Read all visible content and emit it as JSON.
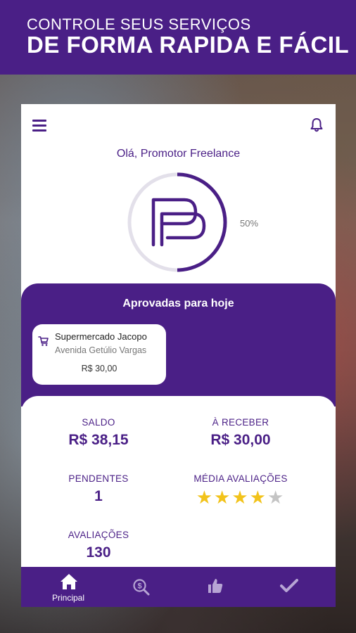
{
  "banner": {
    "line1": "CONTROLE SEUS SERVIÇOS",
    "line2": "DE FORMA RAPIDA E FÁCIL"
  },
  "header": {
    "greeting": "Olá, Promotor Freelance",
    "progress_label": "50%",
    "progress": 0.5
  },
  "approved": {
    "title": "Aprovadas para hoje",
    "items": [
      {
        "name": "Supermercado Jacopo",
        "address": "Avenida Getúlio Vargas",
        "price": "R$ 30,00"
      }
    ]
  },
  "stats": {
    "saldo_label": "SALDO",
    "saldo_value": "R$ 38,15",
    "receber_label": "À RECEBER",
    "receber_value": "R$ 30,00",
    "pendentes_label": "PENDENTES",
    "pendentes_value": "1",
    "media_label": "MÉDIA AVALIAÇÕES",
    "rating": 4,
    "rating_max": 5,
    "avaliacoes_label": "AVALIAÇÕES",
    "avaliacoes_value": "130"
  },
  "nav": {
    "items": [
      {
        "icon": "home-icon",
        "label": "Principal"
      },
      {
        "icon": "search-money-icon",
        "label": ""
      },
      {
        "icon": "thumbs-up-icon",
        "label": ""
      },
      {
        "icon": "check-icon",
        "label": ""
      }
    ]
  },
  "colors": {
    "primary": "#4a1f86",
    "star": "#f2c31b",
    "star_empty": "#c4c4c4",
    "ring_track": "#e3e0ea"
  }
}
